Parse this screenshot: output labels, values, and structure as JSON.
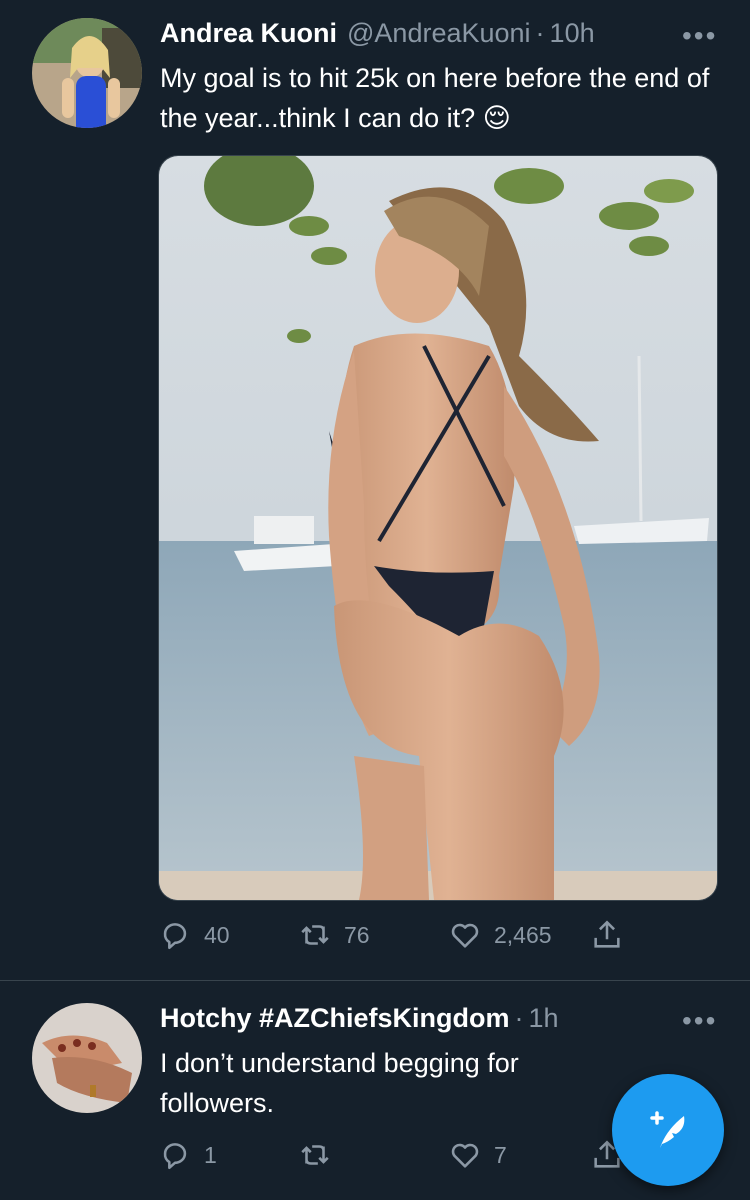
{
  "tweet1": {
    "name": "Andrea Kuoni",
    "handle": "@AndreaKuoni",
    "separator": "·",
    "time": "10h",
    "more": "•••",
    "text": "My goal is to hit 25k on here before the end of the year...think I can do it? 😌",
    "replies": "40",
    "retweets": "76",
    "likes": "2,465"
  },
  "tweet2": {
    "name": "Hotchy #AZChiefsKingdom",
    "separator": "·",
    "time": "1h",
    "more": "•••",
    "text": "I don’t understand begging for followers.",
    "replies": "1",
    "retweets": "",
    "likes": "7"
  },
  "colors": {
    "background": "#15202b",
    "secondary_text": "#8b98a5",
    "accent": "#1d9bf0",
    "divider": "#38444d"
  },
  "icons": [
    "reply-icon",
    "retweet-icon",
    "like-icon",
    "share-icon",
    "compose-tweet-icon"
  ]
}
